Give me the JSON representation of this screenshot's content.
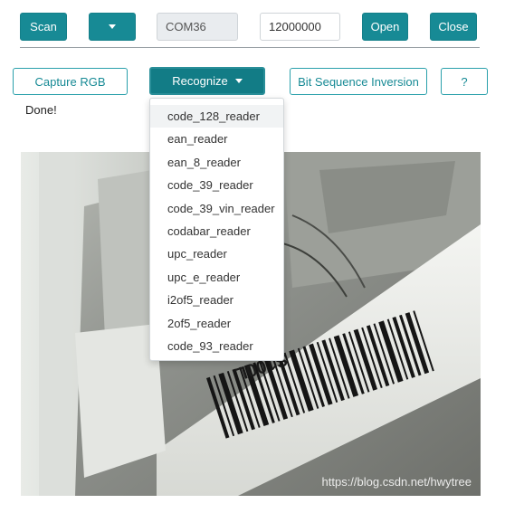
{
  "toolbar": {
    "scan_label": "Scan",
    "port_value": "COM36",
    "baud_value": "12000000",
    "open_label": "Open",
    "close_label": "Close"
  },
  "actions": {
    "capture_label": "Capture RGB",
    "recognize_label": "Recognize",
    "bit_inversion_label": "Bit Sequence Inversion",
    "help_label": "?"
  },
  "status": {
    "text": "Done!"
  },
  "recognize_menu": {
    "items": [
      "code_128_reader",
      "ean_reader",
      "ean_8_reader",
      "code_39_reader",
      "code_39_vin_reader",
      "codabar_reader",
      "upc_reader",
      "upc_e_reader",
      "i2of5_reader",
      "2of5_reader",
      "code_93_reader"
    ],
    "highlighted_index": 0
  },
  "camera": {
    "label_text": "S100L",
    "watermark": "https://blog.csdn.net/hwytree"
  },
  "colors": {
    "accent": "#178a95",
    "accent_border": "#2aa0ab"
  }
}
